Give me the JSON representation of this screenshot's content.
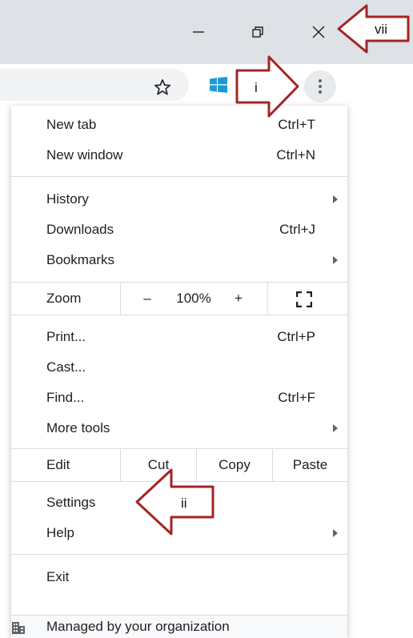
{
  "window_controls": {
    "minimize_icon": "minimize-icon",
    "restore_icon": "restore-icon",
    "close_icon": "close-icon"
  },
  "toolbar": {
    "bookmark_icon": "star-icon",
    "extension_icon": "windows-logo-icon",
    "menu_icon": "three-dot-menu-icon"
  },
  "menu": {
    "new_tab": {
      "label": "New tab",
      "shortcut": "Ctrl+T"
    },
    "new_window": {
      "label": "New window",
      "shortcut": "Ctrl+N"
    },
    "history": {
      "label": "History"
    },
    "downloads": {
      "label": "Downloads",
      "shortcut": "Ctrl+J"
    },
    "bookmarks": {
      "label": "Bookmarks"
    },
    "zoom": {
      "label": "Zoom",
      "minus": "–",
      "value": "100%",
      "plus": "+"
    },
    "print": {
      "label": "Print...",
      "shortcut": "Ctrl+P"
    },
    "cast": {
      "label": "Cast..."
    },
    "find": {
      "label": "Find...",
      "shortcut": "Ctrl+F"
    },
    "more_tools": {
      "label": "More tools"
    },
    "edit": {
      "label": "Edit",
      "cut": "Cut",
      "copy": "Copy",
      "paste": "Paste"
    },
    "settings": {
      "label": "Settings"
    },
    "help": {
      "label": "Help"
    },
    "exit": {
      "label": "Exit"
    },
    "managed": {
      "label": "Managed by your organization"
    }
  },
  "annotations": {
    "i": "i",
    "ii": "ii",
    "vii": "vii",
    "arrow_color": "#a32424"
  }
}
